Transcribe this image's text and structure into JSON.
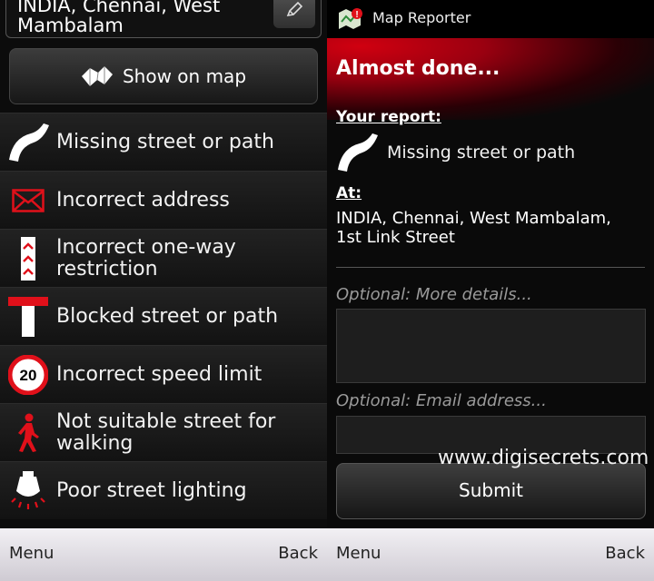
{
  "left": {
    "address_field": "INDIA, Chennai, West Mambalam",
    "show_on_map": "Show on map",
    "items": [
      {
        "label": "Missing street or path",
        "icon": "road-curve-icon"
      },
      {
        "label": "Incorrect address",
        "icon": "envelope-icon"
      },
      {
        "label": "Incorrect one-way restriction",
        "icon": "one-way-arrows-icon"
      },
      {
        "label": "Blocked street or path",
        "icon": "blocked-road-icon"
      },
      {
        "label": "Incorrect speed limit",
        "icon": "speed-limit-icon",
        "speed_value": "20"
      },
      {
        "label": "Not suitable street for walking",
        "icon": "pedestrian-icon"
      },
      {
        "label": "Poor street lighting",
        "icon": "street-lamp-icon"
      }
    ],
    "softkeys": {
      "left": "Menu",
      "right": "Back"
    }
  },
  "right": {
    "app_title": "Map Reporter",
    "heading": "Almost done...",
    "your_report_label": "Your report:",
    "report_type": "Missing street or path",
    "at_label": "At:",
    "at_value": "INDIA, Chennai, West Mambalam, 1st Link Street",
    "details_placeholder": "Optional: More details...",
    "email_placeholder": "Optional: Email address...",
    "details_value": "",
    "email_value": "",
    "submit": "Submit",
    "watermark": "www.digisecrets.com",
    "softkeys": {
      "left": "Menu",
      "right": "Back"
    }
  },
  "colors": {
    "accent_red": "#e0101a",
    "softkey_bg": "#e6e3ea"
  }
}
